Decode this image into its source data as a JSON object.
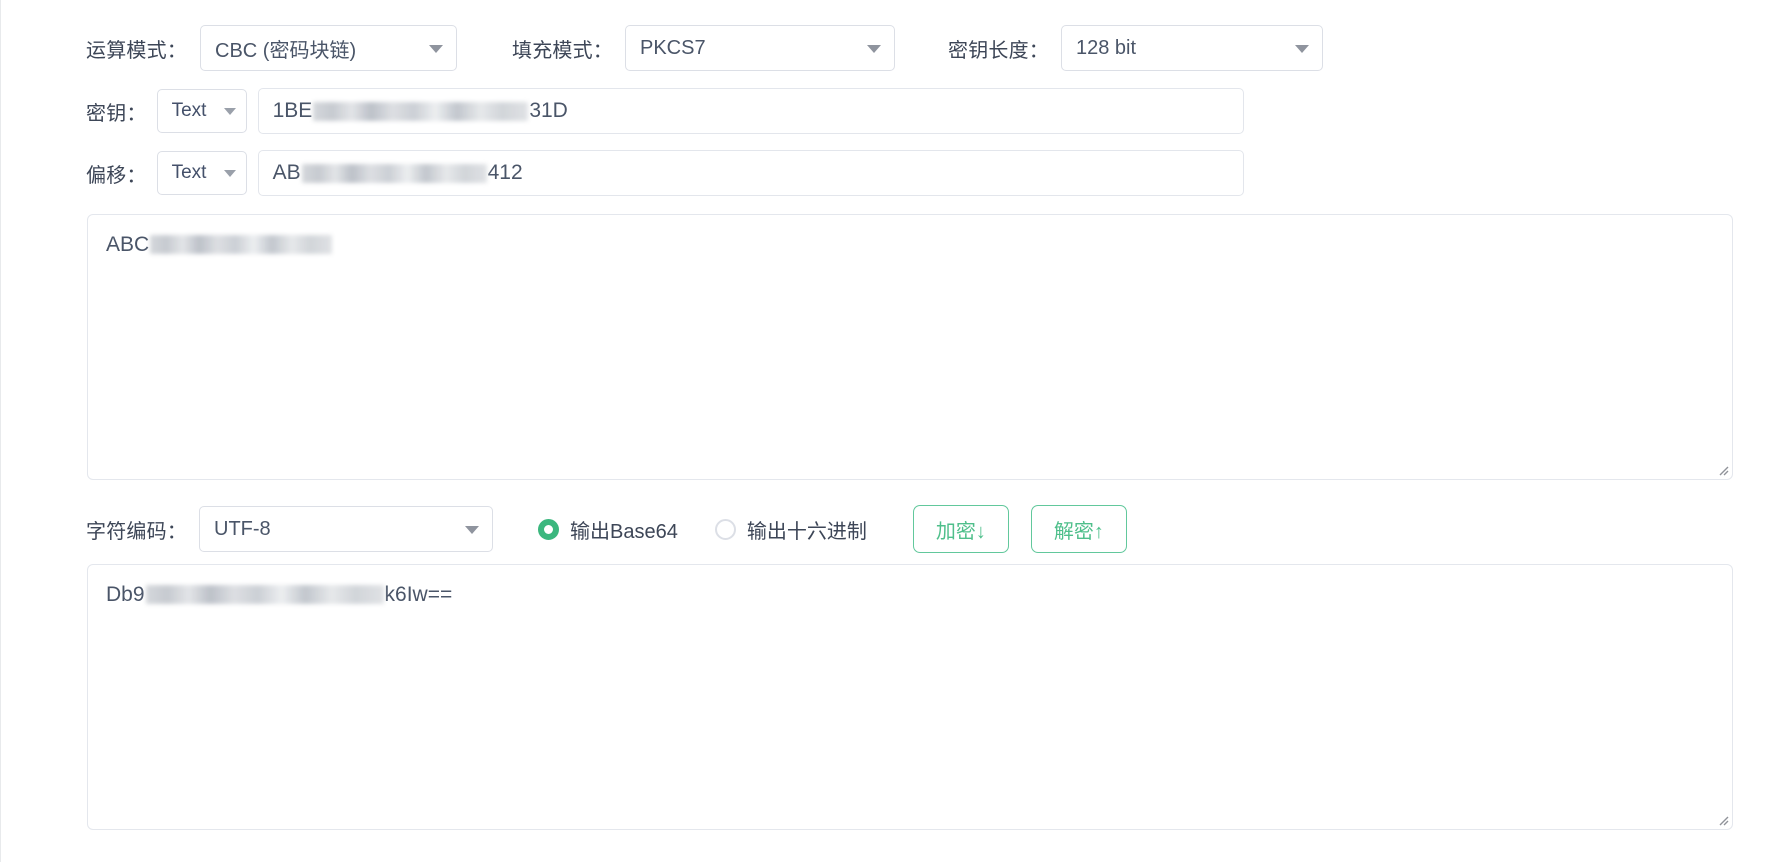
{
  "form": {
    "mode": {
      "label": "运算模式：",
      "value": "CBC (密码块链)",
      "icon": "chevron-down-icon"
    },
    "padding": {
      "label": "填充模式：",
      "value": "PKCS7",
      "icon": "chevron-down-icon"
    },
    "key_length": {
      "label": "密钥长度：",
      "value": "128 bit",
      "icon": "chevron-down-icon"
    },
    "key": {
      "label": "密钥：",
      "type_value": "Text",
      "value_prefix": "1BE",
      "value_suffix": "31D",
      "redacted": true
    },
    "iv": {
      "label": "偏移：",
      "type_value": "Text",
      "value_prefix": "AB",
      "value_suffix": "412",
      "redacted": true
    },
    "input_textarea": {
      "value_prefix": "ABC",
      "value_suffix": "",
      "redacted": true,
      "resize_icon": "resize-grip-icon"
    },
    "charset": {
      "label": "字符编码：",
      "value": "UTF-8",
      "icon": "chevron-down-icon"
    },
    "output_base64": {
      "label": "输出Base64",
      "selected": true
    },
    "output_hex": {
      "label": "输出十六进制",
      "selected": false
    },
    "encrypt_button": {
      "label": "加密↓"
    },
    "decrypt_button": {
      "label": "解密↑"
    },
    "output_textarea": {
      "value_prefix": "Db9",
      "value_suffix": "k6Iw==",
      "redacted": true,
      "resize_icon": "resize-grip-icon"
    }
  },
  "colors": {
    "accent_green": "#3bb77e",
    "button_border": "#62c89c",
    "text_primary": "#3d4657",
    "border": "#dcdfe6"
  }
}
